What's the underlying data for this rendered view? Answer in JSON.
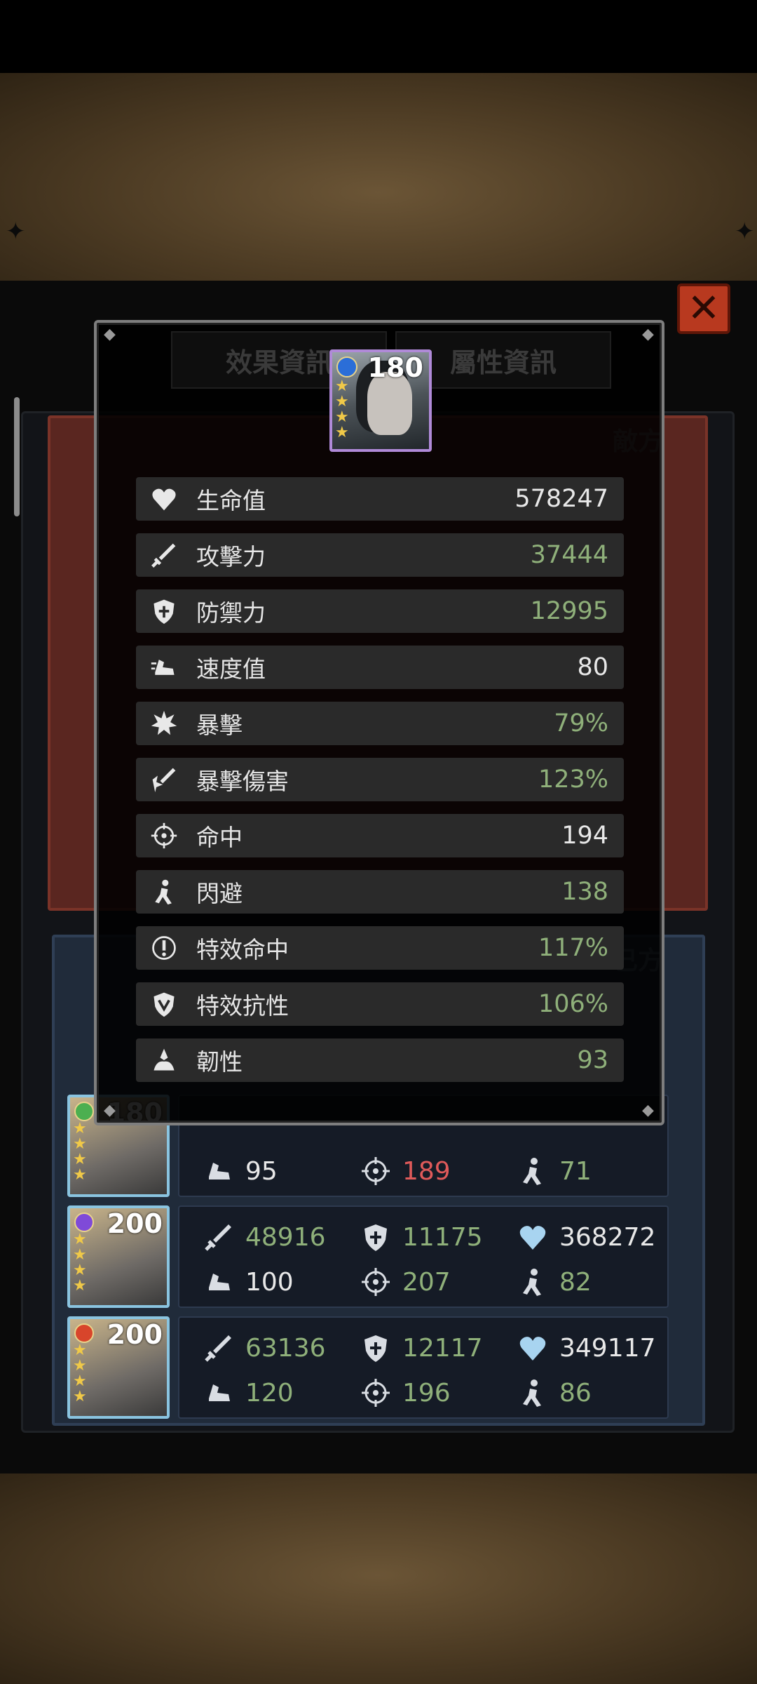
{
  "modal": {
    "tabs": [
      "效果資訊",
      "屬性資訊"
    ],
    "hero": {
      "level": "180",
      "stars": 4
    },
    "stats": [
      {
        "label": "生命值",
        "value": "578247",
        "tone": "white",
        "icon": "heart-icon"
      },
      {
        "label": "攻擊力",
        "value": "37444",
        "tone": "green",
        "icon": "sword-icon"
      },
      {
        "label": "防禦力",
        "value": "12995",
        "tone": "green",
        "icon": "shield-icon"
      },
      {
        "label": "速度值",
        "value": "80",
        "tone": "white",
        "icon": "speed-boot-icon"
      },
      {
        "label": "暴擊",
        "value": "79%",
        "tone": "green",
        "icon": "crit-burst-icon"
      },
      {
        "label": "暴擊傷害",
        "value": "123%",
        "tone": "green",
        "icon": "crit-damage-icon"
      },
      {
        "label": "命中",
        "value": "194",
        "tone": "white",
        "icon": "crosshair-icon"
      },
      {
        "label": "閃避",
        "value": "138",
        "tone": "green",
        "icon": "dodge-icon"
      },
      {
        "label": "特效命中",
        "value": "117%",
        "tone": "green",
        "icon": "effect-hit-icon"
      },
      {
        "label": "特效抗性",
        "value": "106%",
        "tone": "green",
        "icon": "effect-resist-icon"
      },
      {
        "label": "韌性",
        "value": "93",
        "tone": "green",
        "icon": "tenacity-icon"
      }
    ]
  },
  "panel": {
    "enemy_label": "敵方",
    "ally_label": "己方"
  },
  "ally_rows": [
    {
      "level": "180",
      "elem_color": "#4caf50",
      "atk": "",
      "def": "",
      "hp": "",
      "spd": "95",
      "spd_tone": "white",
      "acc": "189",
      "acc_tone": "red",
      "eva": "71",
      "eva_tone": "green"
    },
    {
      "level": "200",
      "elem_color": "#7f4ad8",
      "atk": "48916",
      "atk_tone": "green",
      "def": "11175",
      "def_tone": "green",
      "hp": "368272",
      "hp_tone": "white",
      "spd": "100",
      "spd_tone": "white",
      "acc": "207",
      "acc_tone": "green",
      "eva": "82",
      "eva_tone": "green"
    },
    {
      "level": "200",
      "elem_color": "#d8452b",
      "atk": "63136",
      "atk_tone": "green",
      "def": "12117",
      "def_tone": "green",
      "hp": "349117",
      "hp_tone": "white",
      "spd": "120",
      "spd_tone": "green",
      "acc": "196",
      "acc_tone": "green",
      "eva": "86",
      "eva_tone": "green"
    }
  ],
  "colors": {
    "green_value": "#8fb07a",
    "white_value": "#e8e8e8",
    "red_value": "#e05a5a",
    "close_button": "#b8391f"
  }
}
